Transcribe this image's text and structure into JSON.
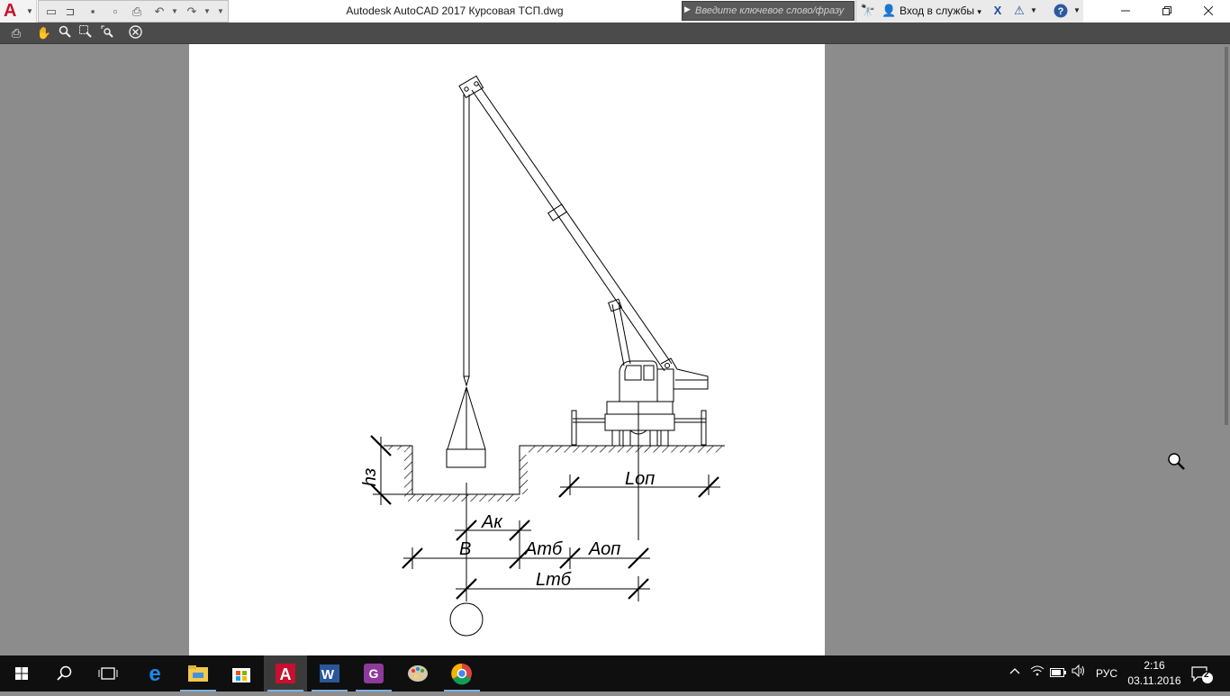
{
  "window": {
    "title": "Autodesk AutoCAD 2017    Курсовая ТСП.dwg",
    "search_placeholder": "Введите ключевое слово/фразу",
    "signin_label": "Вход в службы",
    "signin_arrow": "▾"
  },
  "drawing": {
    "dimensions": {
      "h3": "hз",
      "lop": "Lоп",
      "ak": "Ак",
      "b": "В",
      "atb": "Атб",
      "aop": "Аоп",
      "ltb": "Lтб"
    }
  },
  "taskbar": {
    "language": "РУС",
    "time": "2:16",
    "date": "03.11.2016",
    "notifications_count": "2"
  },
  "colors": {
    "accent_red": "#c8102e",
    "toolbar_dark": "#4b4b4b",
    "canvas_gray": "#8c8c8c"
  }
}
